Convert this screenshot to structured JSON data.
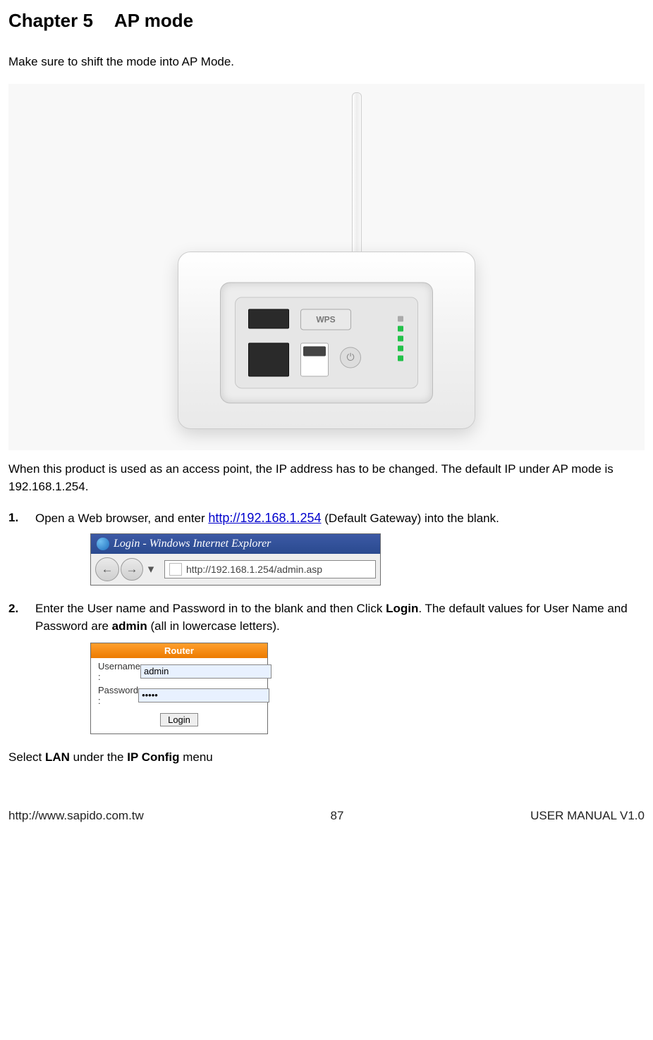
{
  "heading": {
    "chapter": "Chapter 5",
    "title": "AP mode"
  },
  "intro": "Make sure to shift the mode into AP Mode.",
  "router": {
    "wps_label": "WPS"
  },
  "after_image_text": "When this product is used as an access point, the IP address has to be changed.    The default IP under AP mode is 192.168.1.254.",
  "steps": {
    "s1": {
      "num": "1.",
      "pre": "Open a Web browser, and enter ",
      "url_text": "http://192.168.1.254",
      "post": " (Default Gateway) into the blank."
    },
    "s2": {
      "num": "2.",
      "pre": "Enter the User name and Password in to the blank and then Click ",
      "bold1": "Login",
      "mid": ".    The default values for User Name and Password are ",
      "bold2": "admin",
      "post": " (all in lowercase letters)."
    }
  },
  "browser": {
    "title": "Login - Windows Internet Explorer",
    "address": "http://192.168.1.254/admin.asp"
  },
  "login": {
    "header": "Router",
    "username_label": "Username :",
    "password_label": "Password :",
    "username_value": "admin",
    "password_value": "•••••",
    "submit": "Login"
  },
  "last_line": {
    "pre": "Select ",
    "bold1": "LAN",
    "mid": " under the ",
    "bold2": "IP Config",
    "post": " menu"
  },
  "footer": {
    "left": "http://www.sapido.com.tw",
    "center": "87",
    "right": "USER MANUAL V1.0"
  }
}
